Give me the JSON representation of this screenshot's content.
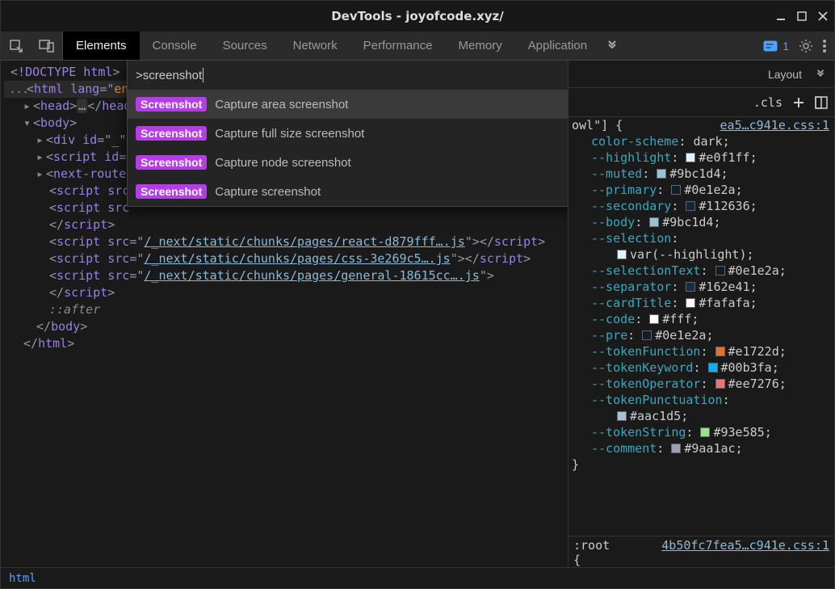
{
  "window": {
    "title": "DevTools - joyofcode.xyz/"
  },
  "toolbar": {
    "tabs": [
      "Elements",
      "Console",
      "Sources",
      "Network",
      "Performance",
      "Memory",
      "Application"
    ],
    "active_tab_index": 0,
    "issues_count": "1"
  },
  "command_menu": {
    "query": ">screenshot",
    "items": [
      {
        "kind": "Screenshot",
        "label": "Capture area screenshot"
      },
      {
        "kind": "Screenshot",
        "label": "Capture full size screenshot"
      },
      {
        "kind": "Screenshot",
        "label": "Capture node screenshot"
      },
      {
        "kind": "Screenshot",
        "label": "Capture screenshot"
      }
    ],
    "selected_index": 0
  },
  "styles_tabs": {
    "right_tab": "Layout"
  },
  "styles_toolbar": {
    "cls": ".cls"
  },
  "breadcrumb": {
    "path": "html"
  },
  "dom": {
    "doctype": "<!DOCTYPE html>",
    "html_attrs": "lang=\"en",
    "head_open": "head",
    "head_close": "head",
    "body_open": "body",
    "div_id": "_",
    "script_id_attr": "id=\"_",
    "next_announcer": "next-route-announcer",
    "lines_script_src_partial": [
      "/_next/static/chunks/pages/react-d879fff….js",
      "/_next/static/chunks/pages/css-3e269c5….js",
      "/_next/static/chunks/pages/general-18615cc….js"
    ],
    "pseudo_after": "::after",
    "body_close": "body",
    "html_close": "html"
  },
  "styles": {
    "source_short": "ea5…c941e.css:1",
    "selector": "owl\"] {",
    "decls": [
      {
        "prop": "color-scheme",
        "val": "dark",
        "swatch": null
      },
      {
        "prop": "--highlight",
        "val": "#e0f1ff",
        "swatch": "#e0f1ff"
      },
      {
        "prop": "--muted",
        "val": "#9bc1d4",
        "swatch": "#9bc1d4"
      },
      {
        "prop": "--primary",
        "val": "#0e1e2a",
        "swatch": "#0e1e2a"
      },
      {
        "prop": "--secondary",
        "val": "#112636",
        "swatch": "#112636"
      },
      {
        "prop": "--body",
        "val": "#9bc1d4",
        "swatch": "#9bc1d4"
      },
      {
        "prop": "--selection",
        "val": "var(--highlight)",
        "swatch": "#e0f1ff",
        "wrap": true
      },
      {
        "prop": "--selectionText",
        "val": "#0e1e2a",
        "swatch": "#0e1e2a"
      },
      {
        "prop": "--separator",
        "val": "#162e41",
        "swatch": "#162e41"
      },
      {
        "prop": "--cardTitle",
        "val": "#fafafa",
        "swatch": "#fafafa"
      },
      {
        "prop": "--code",
        "val": "#fff",
        "swatch": "#ffffff"
      },
      {
        "prop": "--pre",
        "val": "#0e1e2a",
        "swatch": "#0e1e2a"
      },
      {
        "prop": "--tokenFunction",
        "val": "#e1722d",
        "swatch": "#e1722d"
      },
      {
        "prop": "--tokenKeyword",
        "val": "#00b3fa",
        "swatch": "#00b3fa"
      },
      {
        "prop": "--tokenOperator",
        "val": "#ee7276",
        "swatch": "#ee7276"
      },
      {
        "prop": "--tokenPunctuation",
        "val": "#aac1d5",
        "swatch": "#aac1d5",
        "wrap": true
      },
      {
        "prop": "--tokenString",
        "val": "#93e585",
        "swatch": "#93e585"
      },
      {
        "prop": "--comment",
        "val": "#9aa1ac",
        "swatch": "#9aa1ac"
      }
    ],
    "root_rule": {
      "selector": ":root",
      "source": "4b50fc7fea5…c941e.css:1"
    }
  }
}
